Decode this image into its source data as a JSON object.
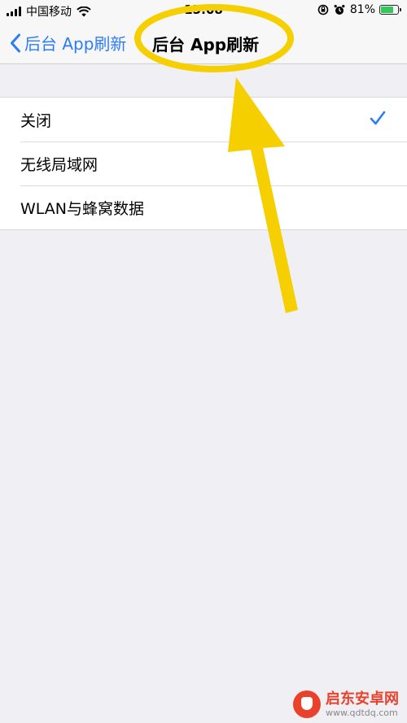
{
  "status_bar": {
    "carrier": "中国移动",
    "time": "15:08",
    "battery_percent": "81%",
    "battery_level": 0.81,
    "icons": [
      "signal-icon",
      "wifi-icon",
      "orientation-lock-icon",
      "alarm-icon",
      "battery-icon"
    ]
  },
  "nav": {
    "back_label": "后台 App刷新",
    "title": "后台 App刷新"
  },
  "options": {
    "items": [
      {
        "label": "关闭",
        "selected": true
      },
      {
        "label": "无线局域网",
        "selected": false
      },
      {
        "label": "WLAN与蜂窝数据",
        "selected": false
      }
    ]
  },
  "watermark": {
    "title": "启东安卓网",
    "url": "www.qdtdq.com"
  },
  "colors": {
    "accent": "#2d7cf6",
    "annotation": "#f5cf00",
    "background": "#f0eff4"
  }
}
